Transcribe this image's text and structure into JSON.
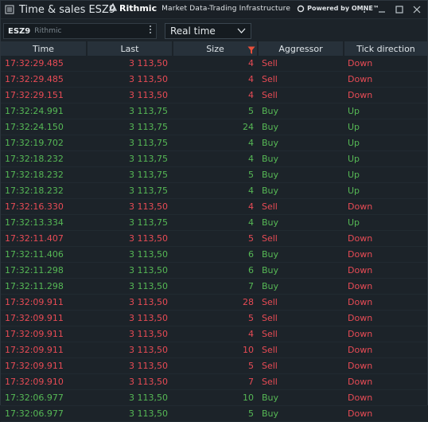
{
  "window": {
    "title": "Time & sales ESZ9",
    "brand_rithmic": "Rithmic",
    "brand_tagline": "Market Data-Trading Infrastructure",
    "brand_powered": "Powered by OMNE™"
  },
  "toolbar": {
    "symbol": "ESZ9",
    "feed": "Rithmic",
    "mode": "Real time"
  },
  "columns": [
    "Time",
    "Last",
    "Size",
    "Aggressor",
    "Tick direction"
  ],
  "colors": {
    "sell": "#e84b55",
    "buy": "#56b855",
    "accent": "#e8503b"
  },
  "rows": [
    {
      "time": "17:32:29.485",
      "last": "3 113,50",
      "size": "4",
      "aggr": "Sell",
      "tick": "Down"
    },
    {
      "time": "17:32:29.485",
      "last": "3 113,50",
      "size": "4",
      "aggr": "Sell",
      "tick": "Down"
    },
    {
      "time": "17:32:29.151",
      "last": "3 113,50",
      "size": "4",
      "aggr": "Sell",
      "tick": "Down"
    },
    {
      "time": "17:32:24.991",
      "last": "3 113,75",
      "size": "5",
      "aggr": "Buy",
      "tick": "Up"
    },
    {
      "time": "17:32:24.150",
      "last": "3 113,75",
      "size": "24",
      "aggr": "Buy",
      "tick": "Up"
    },
    {
      "time": "17:32:19.702",
      "last": "3 113,75",
      "size": "4",
      "aggr": "Buy",
      "tick": "Up"
    },
    {
      "time": "17:32:18.232",
      "last": "3 113,75",
      "size": "4",
      "aggr": "Buy",
      "tick": "Up"
    },
    {
      "time": "17:32:18.232",
      "last": "3 113,75",
      "size": "5",
      "aggr": "Buy",
      "tick": "Up"
    },
    {
      "time": "17:32:18.232",
      "last": "3 113,75",
      "size": "4",
      "aggr": "Buy",
      "tick": "Up"
    },
    {
      "time": "17:32:16.330",
      "last": "3 113,50",
      "size": "4",
      "aggr": "Sell",
      "tick": "Down"
    },
    {
      "time": "17:32:13.334",
      "last": "3 113,75",
      "size": "4",
      "aggr": "Buy",
      "tick": "Up"
    },
    {
      "time": "17:32:11.407",
      "last": "3 113,50",
      "size": "5",
      "aggr": "Sell",
      "tick": "Down"
    },
    {
      "time": "17:32:11.406",
      "last": "3 113,50",
      "size": "6",
      "aggr": "Buy",
      "tick": "Down"
    },
    {
      "time": "17:32:11.298",
      "last": "3 113,50",
      "size": "6",
      "aggr": "Buy",
      "tick": "Down"
    },
    {
      "time": "17:32:11.298",
      "last": "3 113,50",
      "size": "7",
      "aggr": "Buy",
      "tick": "Down"
    },
    {
      "time": "17:32:09.911",
      "last": "3 113,50",
      "size": "28",
      "aggr": "Sell",
      "tick": "Down"
    },
    {
      "time": "17:32:09.911",
      "last": "3 113,50",
      "size": "5",
      "aggr": "Sell",
      "tick": "Down"
    },
    {
      "time": "17:32:09.911",
      "last": "3 113,50",
      "size": "4",
      "aggr": "Sell",
      "tick": "Down"
    },
    {
      "time": "17:32:09.911",
      "last": "3 113,50",
      "size": "10",
      "aggr": "Sell",
      "tick": "Down"
    },
    {
      "time": "17:32:09.911",
      "last": "3 113,50",
      "size": "5",
      "aggr": "Sell",
      "tick": "Down"
    },
    {
      "time": "17:32:09.910",
      "last": "3 113,50",
      "size": "7",
      "aggr": "Sell",
      "tick": "Down"
    },
    {
      "time": "17:32:06.977",
      "last": "3 113,50",
      "size": "10",
      "aggr": "Buy",
      "tick": "Down"
    },
    {
      "time": "17:32:06.977",
      "last": "3 113,50",
      "size": "5",
      "aggr": "Buy",
      "tick": "Down"
    }
  ]
}
